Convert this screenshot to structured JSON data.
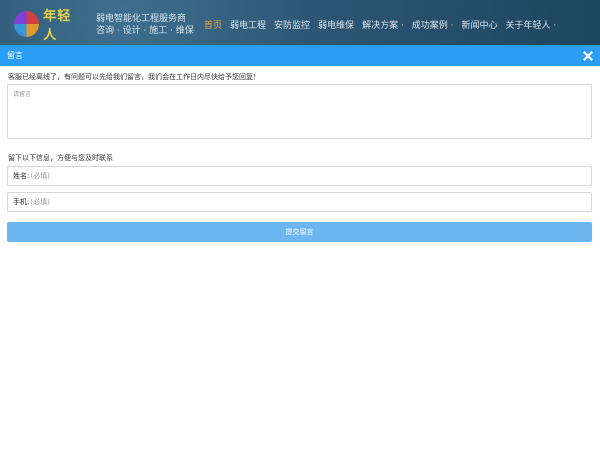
{
  "header": {
    "logo_text": "年轻人",
    "tagline_line1": "弱电智能化工程服务商",
    "tagline_line2": "咨询 · 设计 · 施工 · 维保",
    "nav": [
      {
        "label": "首页",
        "active": true
      },
      {
        "label": "弱电工程"
      },
      {
        "label": "安防监控"
      },
      {
        "label": "弱电维保"
      },
      {
        "label": "解决方案 ·"
      },
      {
        "label": "成功案例 ·"
      },
      {
        "label": "新闻中心"
      },
      {
        "label": "关于年轻人 ·"
      }
    ]
  },
  "dialog": {
    "title": "留言",
    "notice": "客服已经离线了，有问题可以先给我们留言，我们会在工作日内尽快给予您回复！",
    "message_placeholder": "请留言",
    "contact_label": "留下以下信息，方便与您及时联系",
    "name_label": "姓名:",
    "name_placeholder": "(必填)",
    "phone_label": "手机:",
    "phone_placeholder": "(必填)",
    "submit_label": "提交留言"
  },
  "colors": {
    "accent": "#2a9df4",
    "submit_bg": "#6cb6f2",
    "nav_active": "#f0a33a"
  }
}
